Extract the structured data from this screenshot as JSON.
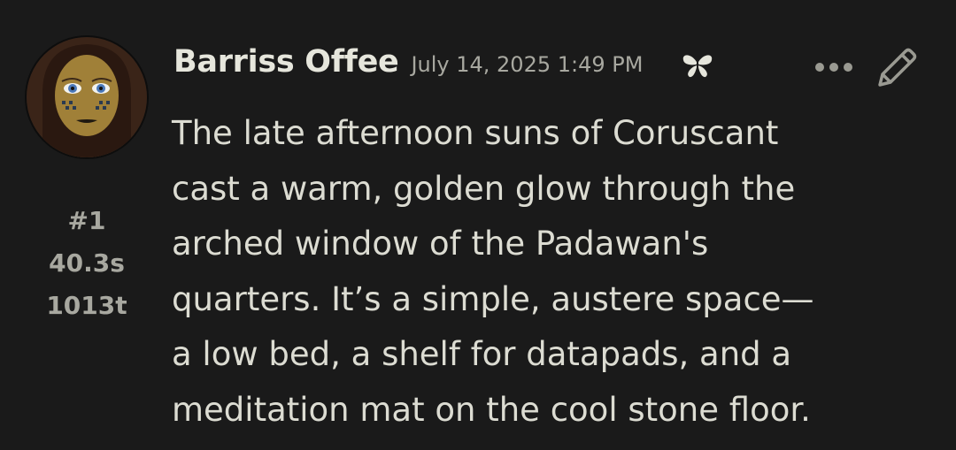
{
  "message": {
    "character_name": "Barriss Offee",
    "timestamp": "July 14, 2025 1:49 PM",
    "index": "#1",
    "response_time": "40.3s",
    "token_count": "1013t",
    "lines": [
      "The late afternoon suns of Coruscant",
      "cast a warm, golden glow through the",
      "arched window of the Padawan's",
      "quarters. It’s a simple, austere space—",
      "a low bed, a shelf for datapads, and a",
      "meditation mat on the cool stone floor."
    ]
  },
  "icons": {
    "avatar": "character-avatar",
    "favorite": "butterfly-icon",
    "more": "more-options-icon",
    "edit": "pencil-edit-icon"
  },
  "colors": {
    "background": "#1a1a1a",
    "text": "#dcdcd2",
    "muted": "#a8a8a0"
  }
}
